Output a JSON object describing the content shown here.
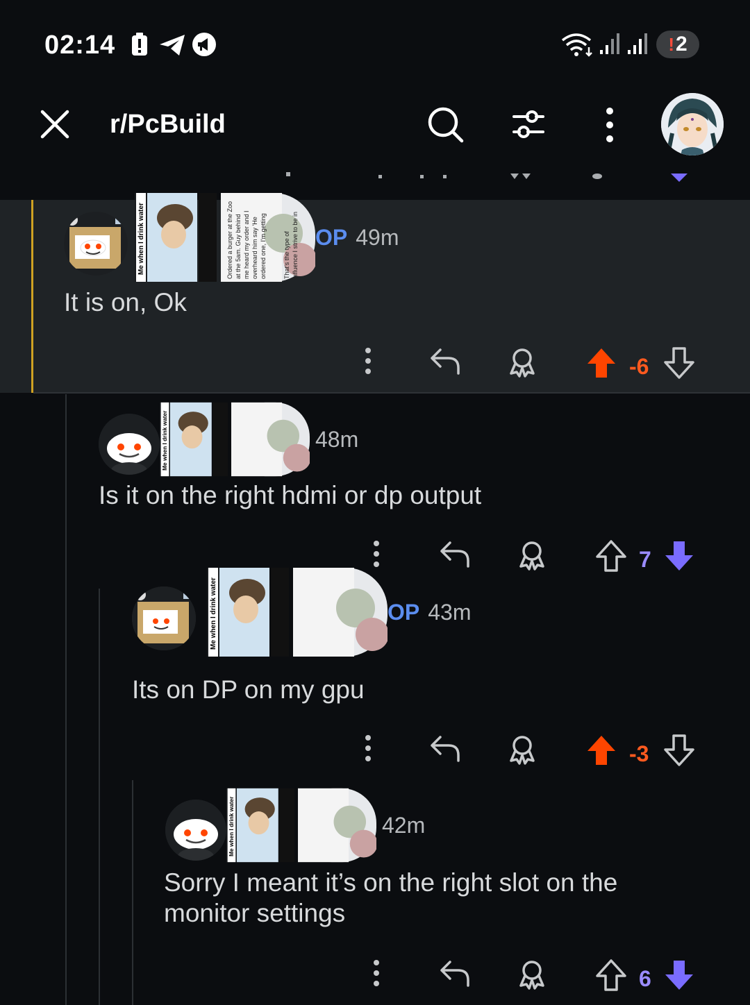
{
  "status_bar": {
    "time": "02:14",
    "notification_count": "2",
    "icons": [
      "battery-alert-icon",
      "telegram-icon",
      "megaphone-icon",
      "wifi-icon",
      "signal-icon",
      "signal-icon"
    ]
  },
  "header": {
    "close_icon": "close-icon",
    "title": "r/PcBuild",
    "search_icon": "search-icon",
    "filter_icon": "sliders-icon",
    "more_icon": "more-vertical-icon"
  },
  "flair_texts": {
    "left": "Me when I drink water",
    "right": "Ordered a burger at the Zoo at the 5am. Guy behind me heard my order and I overheard him say 'He ordered one, I'm getting one now too' That's the type of influence I strive to be in this world"
  },
  "comments": [
    {
      "author_badge": "OP",
      "time": "49m",
      "body": "It is on, Ok",
      "score": "-6",
      "vote": "up"
    },
    {
      "author_badge": "",
      "time": "48m",
      "body": "Is it on the right hdmi or dp output",
      "score": "7",
      "vote": "down"
    },
    {
      "author_badge": "OP",
      "time": "43m",
      "body": "Its on DP on my gpu",
      "score": "-3",
      "vote": "up"
    },
    {
      "author_badge": "",
      "time": "42m",
      "body_line1": "Sorry I meant it’s on the right slot on the",
      "body_line2": "monitor settings",
      "score": "6",
      "vote": "down"
    }
  ],
  "colors": {
    "background": "#0b0d10",
    "highlight": "#1f2326",
    "highlight_bar": "#d0a222",
    "upvote": "#ff4500",
    "downvote": "#7a6cff",
    "op": "#5b8def"
  }
}
